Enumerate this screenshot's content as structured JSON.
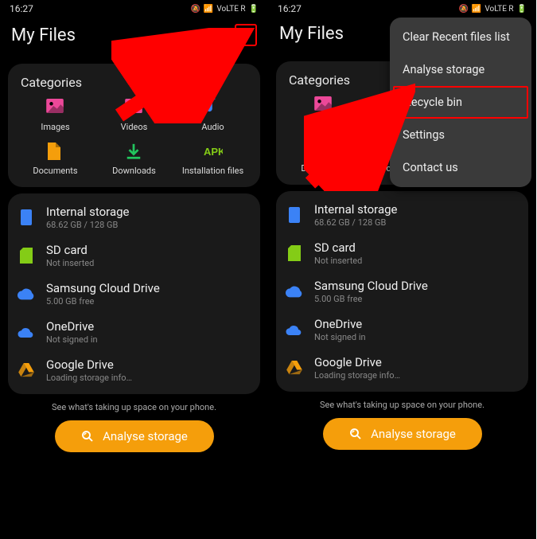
{
  "status": {
    "time": "16:27",
    "net": "VoLTE R"
  },
  "title": "My Files",
  "categories": {
    "heading": "Categories",
    "items": [
      {
        "label": "Images",
        "icon": "image-icon",
        "color": "#ec4899"
      },
      {
        "label": "Videos",
        "icon": "video-icon",
        "color": "#ec4899"
      },
      {
        "label": "Audio",
        "icon": "audio-icon",
        "color": "#3b82f6"
      },
      {
        "label": "Documents",
        "icon": "document-icon",
        "color": "#f59e0b"
      },
      {
        "label": "Downloads",
        "icon": "download-icon",
        "color": "#22c55e"
      },
      {
        "label": "Installation files",
        "icon": "apk-icon",
        "color": "#84cc16"
      }
    ]
  },
  "storage": [
    {
      "title": "Internal storage",
      "sub": "68.62 GB / 128 GB",
      "icon": "phone-storage-icon",
      "color": "#3b82f6"
    },
    {
      "title": "SD card",
      "sub": "Not inserted",
      "icon": "sd-card-icon",
      "color": "#84cc16"
    },
    {
      "title": "Samsung Cloud Drive",
      "sub": "5.00 GB free",
      "icon": "samsung-cloud-icon",
      "color": "#3b82f6"
    },
    {
      "title": "OneDrive",
      "sub": "Not signed in",
      "icon": "onedrive-icon",
      "color": "#3b82f6"
    },
    {
      "title": "Google Drive",
      "sub": "Loading storage info…",
      "icon": "google-drive-icon",
      "color": "#f59e0b"
    }
  ],
  "footer": {
    "hint": "See what's taking up space on your phone.",
    "button": "Analyse storage"
  },
  "menu": {
    "items": [
      {
        "label": "Clear Recent files list",
        "highlight": false
      },
      {
        "label": "Analyse storage",
        "highlight": false
      },
      {
        "label": "Recycle bin",
        "highlight": true
      },
      {
        "label": "Settings",
        "highlight": false
      },
      {
        "label": "Contact us",
        "highlight": false
      }
    ]
  }
}
